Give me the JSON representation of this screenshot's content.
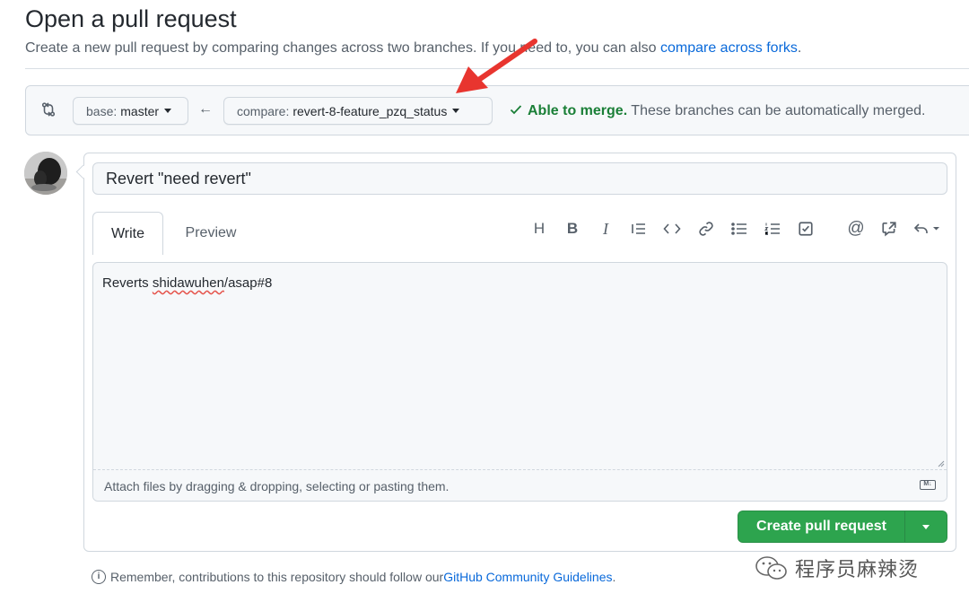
{
  "header": {
    "title": "Open a pull request",
    "subtitle_prefix": "Create a new pull request by comparing changes across two branches. If you need to, you can also ",
    "subtitle_link": "compare across forks",
    "subtitle_suffix": "."
  },
  "compare_bar": {
    "base_label": "base:",
    "base_value": "master",
    "compare_label": "compare:",
    "compare_value": "revert-8-feature_pzq_status",
    "merge_status": "Able to merge.",
    "merge_description": "These branches can be automatically merged."
  },
  "form": {
    "title_value": "Revert \"need revert\"",
    "tabs": {
      "write": "Write",
      "preview": "Preview"
    },
    "toolbar": [
      "heading-icon",
      "bold-icon",
      "italic-icon",
      "quote-icon",
      "code-icon",
      "link-icon",
      "unordered-list-icon",
      "ordered-list-icon",
      "task-list-icon",
      "mention-icon",
      "reference-icon",
      "reply-icon"
    ],
    "body_prefix": "Reverts ",
    "body_underlined": "shidawuhen",
    "body_suffix": "/asap#8",
    "attach_hint": "Attach files by dragging & dropping, selecting or pasting them.",
    "markdown_badge": "M↓"
  },
  "actions": {
    "create_label": "Create pull request"
  },
  "footer": {
    "reminder_prefix": "Remember, contributions to this repository should follow our ",
    "reminder_link": "GitHub Community Guidelines",
    "reminder_suffix": "."
  },
  "watermark": {
    "text": "程序员麻辣烫"
  },
  "colors": {
    "green": "#2da44e",
    "link": "#0969da",
    "merge_ok": "#1a7f37",
    "arrow": "#e8352f"
  }
}
